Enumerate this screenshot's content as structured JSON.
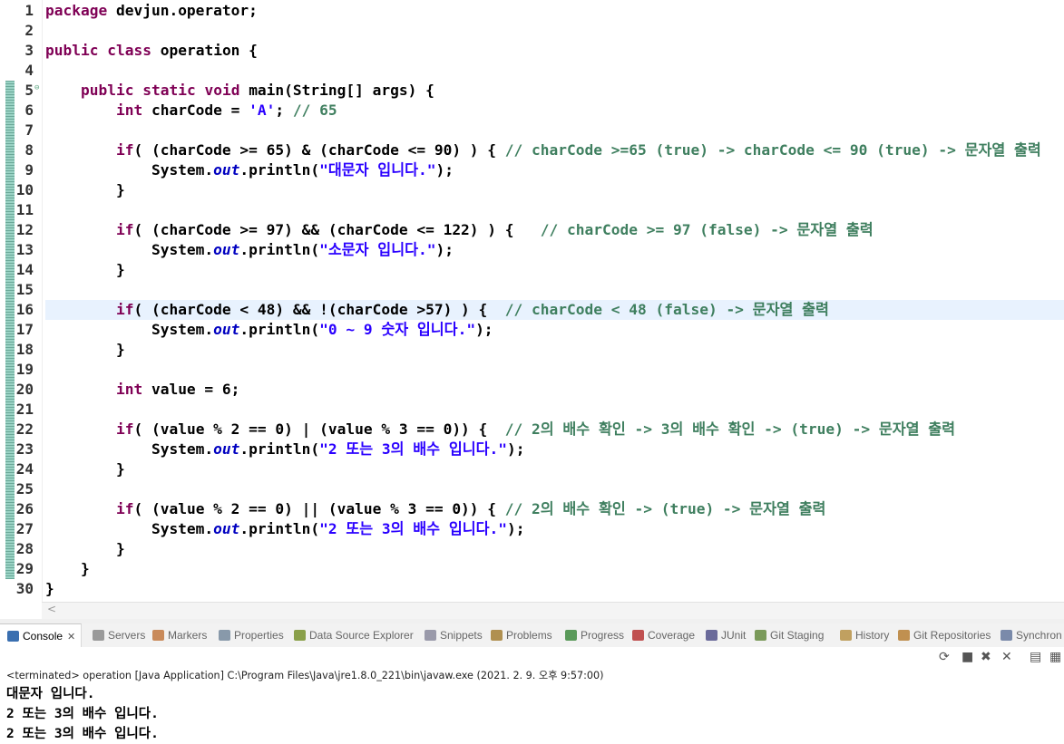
{
  "editor": {
    "line_numbers": [
      "1",
      "2",
      "3",
      "4",
      "5",
      "6",
      "7",
      "8",
      "9",
      "10",
      "11",
      "12",
      "13",
      "14",
      "15",
      "16",
      "17",
      "18",
      "19",
      "20",
      "21",
      "22",
      "23",
      "24",
      "25",
      "26",
      "27",
      "28",
      "29",
      "30"
    ],
    "lines": [
      [
        {
          "t": "package ",
          "c": "kw"
        },
        {
          "t": "devjun.operator;",
          "c": ""
        }
      ],
      [],
      [
        {
          "t": "public ",
          "c": "kw"
        },
        {
          "t": "class ",
          "c": "kw"
        },
        {
          "t": "operation {",
          "c": ""
        }
      ],
      [],
      [
        {
          "t": "    "
        },
        {
          "t": "public ",
          "c": "kw"
        },
        {
          "t": "static ",
          "c": "kw"
        },
        {
          "t": "void ",
          "c": "kw"
        },
        {
          "t": "main(String[] args) {",
          "c": ""
        }
      ],
      [
        {
          "t": "        "
        },
        {
          "t": "int ",
          "c": "kw"
        },
        {
          "t": "charCode = ",
          "c": ""
        },
        {
          "t": "'A'",
          "c": "str"
        },
        {
          "t": "; ",
          "c": ""
        },
        {
          "t": "// 65",
          "c": "cm"
        }
      ],
      [],
      [
        {
          "t": "        "
        },
        {
          "t": "if",
          "c": "kw"
        },
        {
          "t": "( (charCode >= 65) & (charCode <= 90) ) { ",
          "c": ""
        },
        {
          "t": "// charCode >=65 (true) -> charCode <= 90 (true) -> 문자열 출력",
          "c": "cm"
        }
      ],
      [
        {
          "t": "            System.",
          "c": ""
        },
        {
          "t": "out",
          "c": "fld"
        },
        {
          "t": ".println(",
          "c": ""
        },
        {
          "t": "\"대문자 입니다.\"",
          "c": "str"
        },
        {
          "t": ");",
          "c": ""
        }
      ],
      [
        {
          "t": "        }"
        }
      ],
      [],
      [
        {
          "t": "        "
        },
        {
          "t": "if",
          "c": "kw"
        },
        {
          "t": "( (charCode >= 97) && (charCode <= 122) ) {   ",
          "c": ""
        },
        {
          "t": "// charCode >= 97 (false) -> 문자열 출력",
          "c": "cm"
        }
      ],
      [
        {
          "t": "            System.",
          "c": ""
        },
        {
          "t": "out",
          "c": "fld"
        },
        {
          "t": ".println(",
          "c": ""
        },
        {
          "t": "\"소문자 입니다.\"",
          "c": "str"
        },
        {
          "t": ");",
          "c": ""
        }
      ],
      [
        {
          "t": "        }"
        }
      ],
      [],
      [
        {
          "t": "        "
        },
        {
          "t": "if",
          "c": "kw"
        },
        {
          "t": "( (charCode < 48) && !(charCode >57) ) {  ",
          "c": ""
        },
        {
          "t": "// charCode < 48 (false) -> 문자열 출력",
          "c": "cm"
        }
      ],
      [
        {
          "t": "            System.",
          "c": ""
        },
        {
          "t": "out",
          "c": "fld"
        },
        {
          "t": ".println(",
          "c": ""
        },
        {
          "t": "\"0 ~ 9 숫자 입니다.\"",
          "c": "str"
        },
        {
          "t": ");",
          "c": ""
        }
      ],
      [
        {
          "t": "        }"
        }
      ],
      [],
      [
        {
          "t": "        "
        },
        {
          "t": "int ",
          "c": "kw"
        },
        {
          "t": "value = 6;",
          "c": ""
        }
      ],
      [],
      [
        {
          "t": "        "
        },
        {
          "t": "if",
          "c": "kw"
        },
        {
          "t": "( (value % 2 == 0) | (value % 3 == 0)) {  ",
          "c": ""
        },
        {
          "t": "// 2의 배수 확인 -> 3의 배수 확인 -> (true) -> 문자열 출력",
          "c": "cm"
        }
      ],
      [
        {
          "t": "            System.",
          "c": ""
        },
        {
          "t": "out",
          "c": "fld"
        },
        {
          "t": ".println(",
          "c": ""
        },
        {
          "t": "\"2 또는 3의 배수 입니다.\"",
          "c": "str"
        },
        {
          "t": ");",
          "c": ""
        }
      ],
      [
        {
          "t": "        }"
        }
      ],
      [],
      [
        {
          "t": "        "
        },
        {
          "t": "if",
          "c": "kw"
        },
        {
          "t": "( (value % 2 == 0) || (value % 3 == 0)) { ",
          "c": ""
        },
        {
          "t": "// 2의 배수 확인 -> (true) -> 문자열 출력",
          "c": "cm"
        }
      ],
      [
        {
          "t": "            System.",
          "c": ""
        },
        {
          "t": "out",
          "c": "fld"
        },
        {
          "t": ".println(",
          "c": ""
        },
        {
          "t": "\"2 또는 3의 배수 입니다.\"",
          "c": "str"
        },
        {
          "t": ");",
          "c": ""
        }
      ],
      [
        {
          "t": "        }"
        }
      ],
      [
        {
          "t": "    }"
        }
      ],
      [
        {
          "t": "}"
        }
      ]
    ],
    "current_line": 16
  },
  "tabs": [
    {
      "label": "Console",
      "icon": "console-icon",
      "color": "#3a6fb0",
      "active": true
    },
    {
      "label": "Servers",
      "icon": "servers-icon",
      "color": "#9a9a9a"
    },
    {
      "label": "Markers",
      "icon": "markers-icon",
      "color": "#c98a5a"
    },
    {
      "label": "Properties",
      "icon": "properties-icon",
      "color": "#8899aa"
    },
    {
      "label": "Data Source Explorer",
      "icon": "data-source-icon",
      "color": "#8aa04a"
    },
    {
      "label": "Snippets",
      "icon": "snippets-icon",
      "color": "#9a9aaa"
    },
    {
      "label": "Problems",
      "icon": "problems-icon",
      "color": "#b09050"
    },
    {
      "label": "Progress",
      "icon": "progress-icon",
      "color": "#5a9a5a"
    },
    {
      "label": "Coverage",
      "icon": "coverage-icon",
      "color": "#c05050"
    },
    {
      "label": "JUnit",
      "icon": "junit-icon",
      "color": "#6a6a9a"
    },
    {
      "label": "Git Staging",
      "icon": "git-staging-icon",
      "color": "#7a9a5a"
    },
    {
      "label": "History",
      "icon": "history-icon",
      "color": "#c0a060"
    },
    {
      "label": "Git Repositories",
      "icon": "git-repositories-icon",
      "color": "#c09050"
    },
    {
      "label": "Synchron",
      "icon": "synchronize-icon",
      "color": "#7a8aaa"
    }
  ],
  "console": {
    "status": "<terminated> operation [Java Application] C:\\Program Files\\Java\\jre1.8.0_221\\bin\\javaw.exe (2021. 2. 9. 오후 9:57:00)",
    "output": [
      "대문자 입니다.",
      "2 또는 3의 배수 입니다.",
      "2 또는 3의 배수 입니다."
    ]
  },
  "toolbar_icons": [
    "remove-launch-icon",
    "terminate-icon",
    "remove-all-icon",
    "close-all-icon",
    "clear-console-icon",
    "scroll-lock-icon"
  ]
}
